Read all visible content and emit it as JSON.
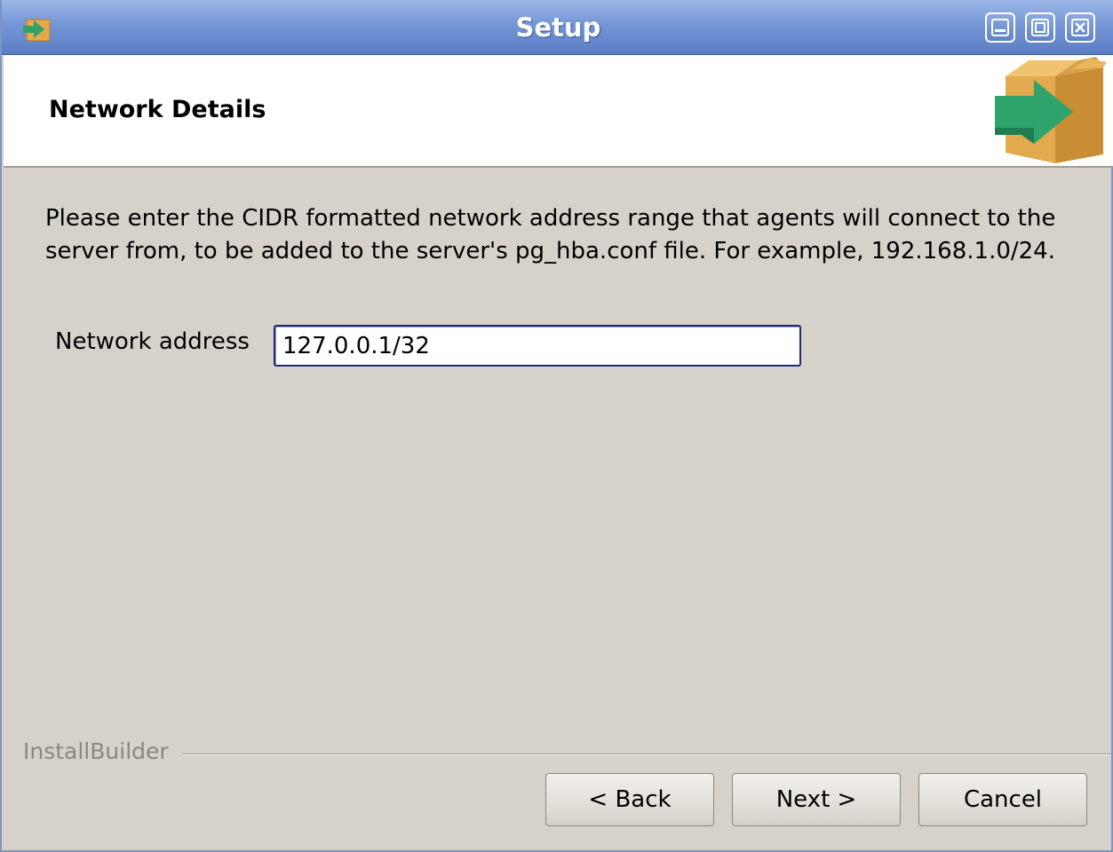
{
  "window": {
    "title": "Setup",
    "controls": [
      "minimize-icon",
      "maximize-icon",
      "close-icon"
    ]
  },
  "header": {
    "title": "Network Details",
    "logo_icon": "installer-box-icon"
  },
  "main": {
    "description": "Please enter the CIDR formatted network address range that agents will connect to the server from, to be added to the server's pg_hba.conf file. For example, 192.168.1.0/24.",
    "network_address": {
      "label": "Network address",
      "value": "127.0.0.1/32"
    }
  },
  "footer": {
    "brand": "InstallBuilder",
    "back_label": "< Back",
    "next_label": "Next >",
    "cancel_label": "Cancel"
  },
  "colors": {
    "titlebar": "#7596d6",
    "dialog_background": "#d6d2ca",
    "input_border": "#1e2a78"
  }
}
